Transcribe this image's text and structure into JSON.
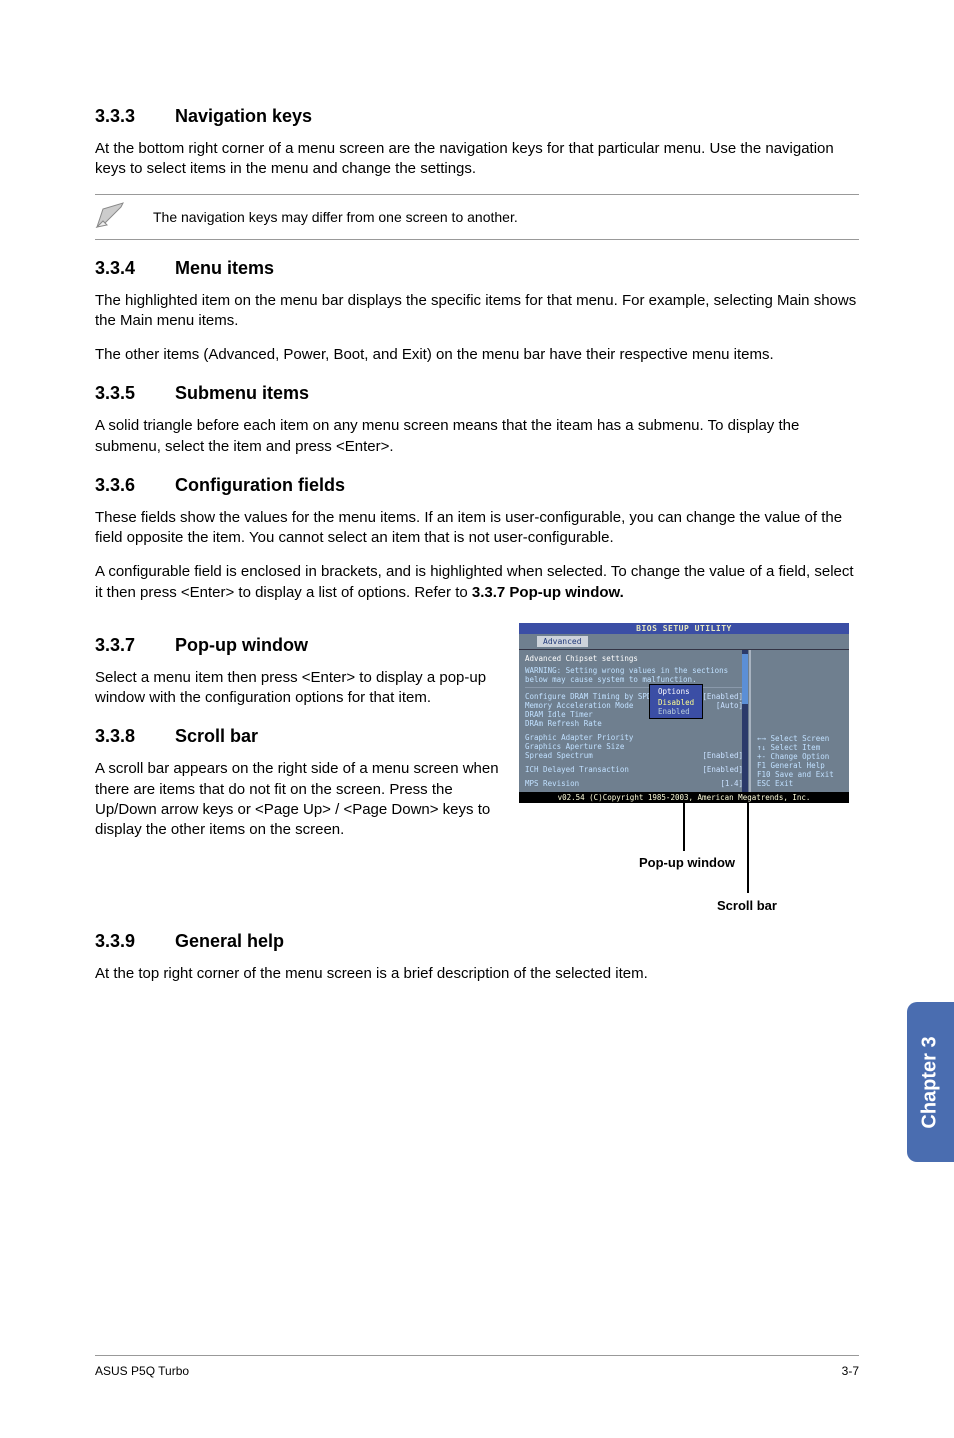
{
  "s333": {
    "num": "3.3.3",
    "title": "Navigation keys",
    "p1": "At the bottom right corner of a menu screen are the navigation keys for that particular menu. Use the navigation keys to select items in the menu and change the settings."
  },
  "note": {
    "text": "The navigation keys may differ from one screen to another."
  },
  "s334": {
    "num": "3.3.4",
    "title": "Menu items",
    "p1": "The highlighted item on the menu bar displays the specific items for that menu. For example, selecting Main shows the Main menu items.",
    "p2": "The other items (Advanced, Power, Boot, and Exit) on the menu bar have their respective menu items."
  },
  "s335": {
    "num": "3.3.5",
    "title": "Submenu items",
    "p1": "A solid triangle before each item on any menu screen means that the iteam has a submenu. To display the submenu, select the item and press <Enter>."
  },
  "s336": {
    "num": "3.3.6",
    "title": "Configuration fields",
    "p1": "These fields show the values for the menu items. If an item is user-configurable, you can change the value of the field opposite the item. You cannot select an item that is not user-configurable.",
    "p2_a": "A configurable field is enclosed in brackets, and is highlighted when selected. To change the value of a field, select it then press <Enter> to display a list of options. Refer to ",
    "p2_b": "3.3.7 Pop-up window."
  },
  "s337": {
    "num": "3.3.7",
    "title": "Pop-up window",
    "p1": "Select a menu item then press <Enter> to display a pop-up window with the configuration options for that item."
  },
  "s338": {
    "num": "3.3.8",
    "title": "Scroll bar",
    "p1": "A scroll bar appears on the right side of a menu screen when there are items that do not fit on the screen. Press the Up/Down arrow keys or <Page Up> / <Page Down> keys to display the other items on the screen."
  },
  "s339": {
    "num": "3.3.9",
    "title": "General help",
    "p1": "At the top right corner of the menu screen is a brief description of the selected item."
  },
  "bios": {
    "title": "BIOS SETUP UTILITY",
    "tab": "Advanced",
    "head": "Advanced Chipset settings",
    "warn": "WARNING: Setting wrong values in the sections below may cause system to malfunction.",
    "r1": {
      "k": "Configure DRAM Timing by SPD",
      "v": "[Enabled]"
    },
    "r2": {
      "k": "Memory Acceleration Mode",
      "v": "[Auto]"
    },
    "r3": {
      "k": "DRAM Idle Timer",
      "v": ""
    },
    "r4": {
      "k": "DRAm Refresh Rate",
      "v": ""
    },
    "r5": {
      "k": "Graphic Adapter Priority",
      "v": ""
    },
    "r6": {
      "k": "Graphics Aperture Size",
      "v": ""
    },
    "r7": {
      "k": "Spread Spectrum",
      "v": "[Enabled]"
    },
    "r8": {
      "k": "ICH Delayed Transaction",
      "v": "[Enabled]"
    },
    "r9": {
      "k": "MPS Revision",
      "v": "[1.4]"
    },
    "popup": {
      "t": "Options",
      "o1": "Disabled",
      "o2": "Enabled"
    },
    "help": {
      "l1": "←→   Select Screen",
      "l2": "↑↓   Select Item",
      "l3": "+-   Change Option",
      "l4": "F1   General Help",
      "l5": "F10  Save and Exit",
      "l6": "ESC  Exit"
    },
    "foot": "v02.54 (C)Copyright 1985-2003, American Megatrends, Inc."
  },
  "callouts": {
    "popup": "Pop-up window",
    "scroll": "Scroll bar"
  },
  "sidetab": "Chapter 3",
  "footer": {
    "left": "ASUS P5Q Turbo",
    "right": "3-7"
  }
}
